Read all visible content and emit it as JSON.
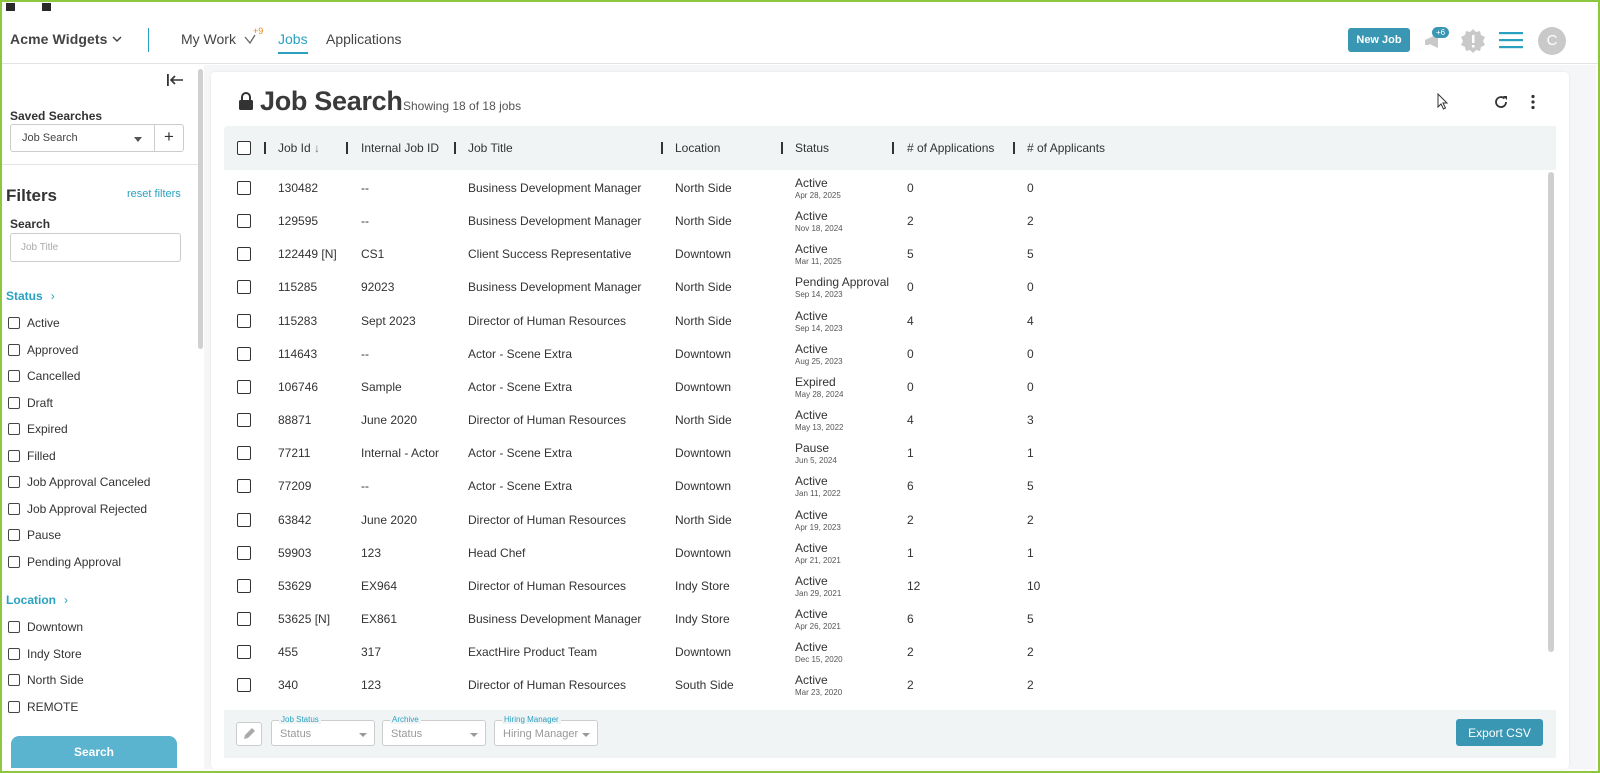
{
  "header": {
    "brand": "Acme Widgets",
    "nav": {
      "my_work": "My Work",
      "my_work_badge": "+9",
      "jobs": "Jobs",
      "applications": "Applications"
    },
    "new_job_label": "New Job",
    "notification_badge": "+6",
    "avatar_initial": "C",
    "accent_color": "#3a97b3"
  },
  "sidebar": {
    "saved_searches_label": "Saved Searches",
    "saved_search_value": "Job Search",
    "add_label": "+",
    "filters_title": "Filters",
    "reset_label": "reset filters",
    "search_label": "Search",
    "search_placeholder": "Job Title",
    "status_section": "Status",
    "status_options": [
      "Active",
      "Approved",
      "Cancelled",
      "Draft",
      "Expired",
      "Filled",
      "Job Approval Canceled",
      "Job Approval Rejected",
      "Pause",
      "Pending Approval"
    ],
    "location_section": "Location",
    "location_options": [
      "Downtown",
      "Indy Store",
      "North Side",
      "REMOTE"
    ],
    "search_button": "Search"
  },
  "main": {
    "title": "Job Search",
    "subtitle": "Showing 18 of 18 jobs",
    "columns": [
      "Job Id",
      "Internal Job ID",
      "Job Title",
      "Location",
      "Status",
      "# of Applications",
      "# of Applicants"
    ],
    "rows": [
      {
        "job_id": "130482",
        "internal_id": "--",
        "title": "Business Development Manager",
        "location": "North Side",
        "status": "Active",
        "date": "Apr 28, 2025",
        "applications": "0",
        "applicants": "0"
      },
      {
        "job_id": "129595",
        "internal_id": "--",
        "title": "Business Development Manager",
        "location": "North Side",
        "status": "Active",
        "date": "Nov 18, 2024",
        "applications": "2",
        "applicants": "2"
      },
      {
        "job_id": "122449 [N]",
        "internal_id": "CS1",
        "title": "Client Success Representative",
        "location": "Downtown",
        "status": "Active",
        "date": "Mar 11, 2025",
        "applications": "5",
        "applicants": "5"
      },
      {
        "job_id": "115285",
        "internal_id": "92023",
        "title": "Business Development Manager",
        "location": "North Side",
        "status": "Pending Approval",
        "date": "Sep 14, 2023",
        "applications": "0",
        "applicants": "0"
      },
      {
        "job_id": "115283",
        "internal_id": "Sept 2023",
        "title": "Director of Human Resources",
        "location": "North Side",
        "status": "Active",
        "date": "Sep 14, 2023",
        "applications": "4",
        "applicants": "4"
      },
      {
        "job_id": "114643",
        "internal_id": "--",
        "title": "Actor - Scene Extra",
        "location": "Downtown",
        "status": "Active",
        "date": "Aug 25, 2023",
        "applications": "0",
        "applicants": "0"
      },
      {
        "job_id": "106746",
        "internal_id": "Sample",
        "title": "Actor - Scene Extra",
        "location": "Downtown",
        "status": "Expired",
        "date": "May 28, 2024",
        "applications": "0",
        "applicants": "0"
      },
      {
        "job_id": "88871",
        "internal_id": "June 2020",
        "title": "Director of Human Resources",
        "location": "North Side",
        "status": "Active",
        "date": "May 13, 2022",
        "applications": "4",
        "applicants": "3"
      },
      {
        "job_id": "77211",
        "internal_id": "Internal - Actor",
        "title": "Actor - Scene Extra",
        "location": "Downtown",
        "status": "Pause",
        "date": "Jun 5, 2024",
        "applications": "1",
        "applicants": "1"
      },
      {
        "job_id": "77209",
        "internal_id": "--",
        "title": "Actor - Scene Extra",
        "location": "Downtown",
        "status": "Active",
        "date": "Jan 11, 2022",
        "applications": "6",
        "applicants": "5"
      },
      {
        "job_id": "63842",
        "internal_id": "June 2020",
        "title": "Director of Human Resources",
        "location": "North Side",
        "status": "Active",
        "date": "Apr 19, 2023",
        "applications": "2",
        "applicants": "2"
      },
      {
        "job_id": "59903",
        "internal_id": "123",
        "title": "Head Chef",
        "location": "Downtown",
        "status": "Active",
        "date": "Apr 21, 2021",
        "applications": "1",
        "applicants": "1"
      },
      {
        "job_id": "53629",
        "internal_id": "EX964",
        "title": "Director of Human Resources",
        "location": "Indy Store",
        "status": "Active",
        "date": "Jan 29, 2021",
        "applications": "12",
        "applicants": "10"
      },
      {
        "job_id": "53625 [N]",
        "internal_id": "EX861",
        "title": "Business Development Manager",
        "location": "Indy Store",
        "status": "Active",
        "date": "Apr 26, 2021",
        "applications": "6",
        "applicants": "5"
      },
      {
        "job_id": "455",
        "internal_id": "317",
        "title": "ExactHire Product Team",
        "location": "Downtown",
        "status": "Active",
        "date": "Dec 15, 2020",
        "applications": "2",
        "applicants": "2"
      },
      {
        "job_id": "340",
        "internal_id": "123",
        "title": "Director of Human Resources",
        "location": "South Side",
        "status": "Active",
        "date": "Mar 23, 2020",
        "applications": "2",
        "applicants": "2"
      }
    ]
  },
  "footer": {
    "job_status_label": "Job Status",
    "job_status_value": "Status",
    "archive_label": "Archive",
    "archive_value": "Status",
    "hiring_manager_label": "Hiring Manager",
    "hiring_manager_value": "Hiring Manager",
    "export_label": "Export CSV"
  }
}
